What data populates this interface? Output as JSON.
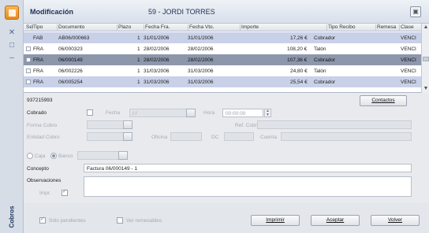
{
  "title": {
    "left": "Modificación",
    "center": "59 - JORDI TORRES"
  },
  "sidebar": {
    "label": "Cobros"
  },
  "grid": {
    "headers": [
      "Sel",
      "Tipo",
      "Documento",
      "Plazo",
      "Fecha Fra.",
      "Fecha Vto.",
      "Importe",
      "Tipo Recibo",
      "Remesa",
      "Clase"
    ],
    "rows": [
      {
        "tipo": "FAB",
        "doc": "AB06/000663",
        "plazo": "1",
        "ffra": "31/01/2006",
        "fvto": "31/01/2006",
        "importe": "17,26 €",
        "recibo": "Cobrador",
        "remesa": "",
        "clase": "VENCI"
      },
      {
        "tipo": "FRA",
        "doc": "06/000323",
        "plazo": "1",
        "ffra": "28/02/2006",
        "fvto": "28/02/2006",
        "importe": "108,20 €",
        "recibo": "Talón",
        "remesa": "",
        "clase": "VENCI"
      },
      {
        "tipo": "FRA",
        "doc": "06/000149",
        "plazo": "1",
        "ffra": "28/02/2006",
        "fvto": "28/02/2006",
        "importe": "107,36 €",
        "recibo": "Cobrador",
        "remesa": "",
        "clase": "VENCI"
      },
      {
        "tipo": "FRA",
        "doc": "06/002226",
        "plazo": "1",
        "ffra": "31/03/2006",
        "fvto": "31/03/2006",
        "importe": "24,80 €",
        "recibo": "Talón",
        "remesa": "",
        "clase": "VENCI"
      },
      {
        "tipo": "FRA",
        "doc": "06/005254",
        "plazo": "1",
        "ffra": "31/03/2006",
        "fvto": "31/03/2006",
        "importe": "25,54 €",
        "recibo": "Cobrador",
        "remesa": "",
        "clase": "VENCI"
      }
    ]
  },
  "form": {
    "phone": "937215993",
    "contactos": "Contactos",
    "cobrado": "Cobrado",
    "fecha_label": "Fecha",
    "fecha_value": "/ /",
    "hora_label": "Hora",
    "hora_value": "00:00:00",
    "forma_cobro": "Forma Cobro",
    "ref_cobro": "Ref. Cobro",
    "entidad_cobro": "Entidad Cobro",
    "oficina": "Oficina",
    "dc": "DC",
    "cuenta": "Cuenta",
    "caja": "Caja",
    "banco": "Banco",
    "concepto_label": "Concepto",
    "concepto_value": "Factura 06/000149 - 1",
    "observaciones": "Observaciones",
    "impr": "Impr."
  },
  "footer": {
    "solo_pendientes": "Sólo pendientes",
    "ver_remesables": "Ver remesables",
    "imprimir": "Imprimir",
    "aceptar": "Aceptar",
    "volver": "Volver"
  }
}
